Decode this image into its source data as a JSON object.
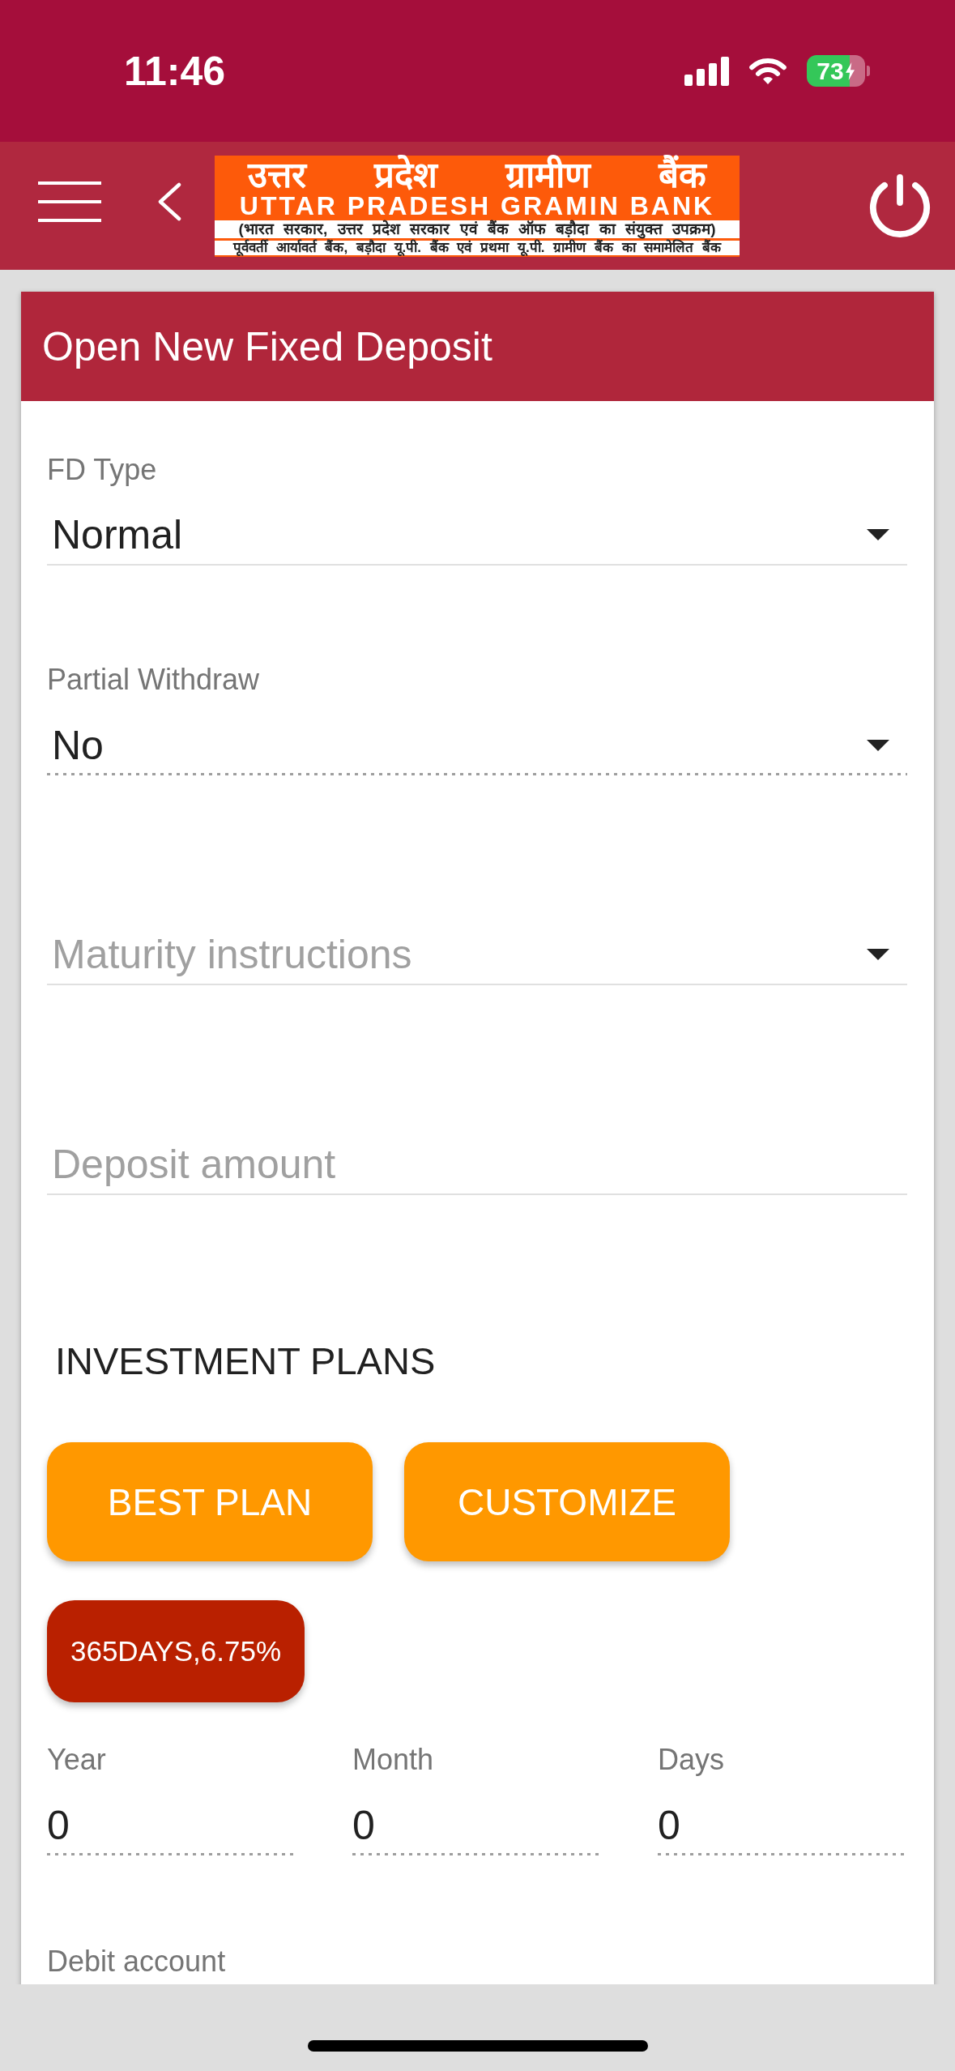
{
  "status_bar": {
    "time": "11:46",
    "battery": "73",
    "charging": true
  },
  "app_bar": {
    "logo": {
      "hindi_name": "उत्तर प्रदेश ग्रामीण बैंक",
      "english_name": "UTTAR PRADESH GRAMIN BANK",
      "subtitle": "(भारत सरकार, उत्तर प्रदेश सरकार एवं बैंक ऑफ बड़ौदा का संयुक्त उपक्रम)",
      "tagline": "पूर्ववर्ती आर्यावर्त बैंक, बड़ौदा यू.पी. बैंक एवं प्रथमा यू.पी. ग्रामीण बैंक का समामेलित बैंक"
    }
  },
  "form": {
    "title": "Open New Fixed Deposit",
    "fields": [
      {
        "kind": "dropdown",
        "label": "FD Type",
        "value": "Normal",
        "disabled": false
      },
      {
        "kind": "dropdown",
        "label": "Partial Withdraw",
        "value": "No",
        "disabled": true
      },
      {
        "kind": "dropdown",
        "placeholder": "Maturity instructions",
        "disabled": false
      },
      {
        "kind": "text",
        "placeholder": "Deposit amount",
        "disabled": false
      }
    ],
    "investment_plans": {
      "heading": "INVESTMENT PLANS",
      "buttons": [
        "BEST PLAN",
        "CUSTOMIZE"
      ],
      "plan_chip": "365DAYS,6.75%"
    },
    "tenure": [
      {
        "label": "Year",
        "value": "0",
        "disabled": true
      },
      {
        "label": "Month",
        "value": "0",
        "disabled": true
      },
      {
        "label": "Days",
        "value": "0",
        "disabled": true
      }
    ],
    "debit_account": {
      "label": "Debit account"
    }
  }
}
